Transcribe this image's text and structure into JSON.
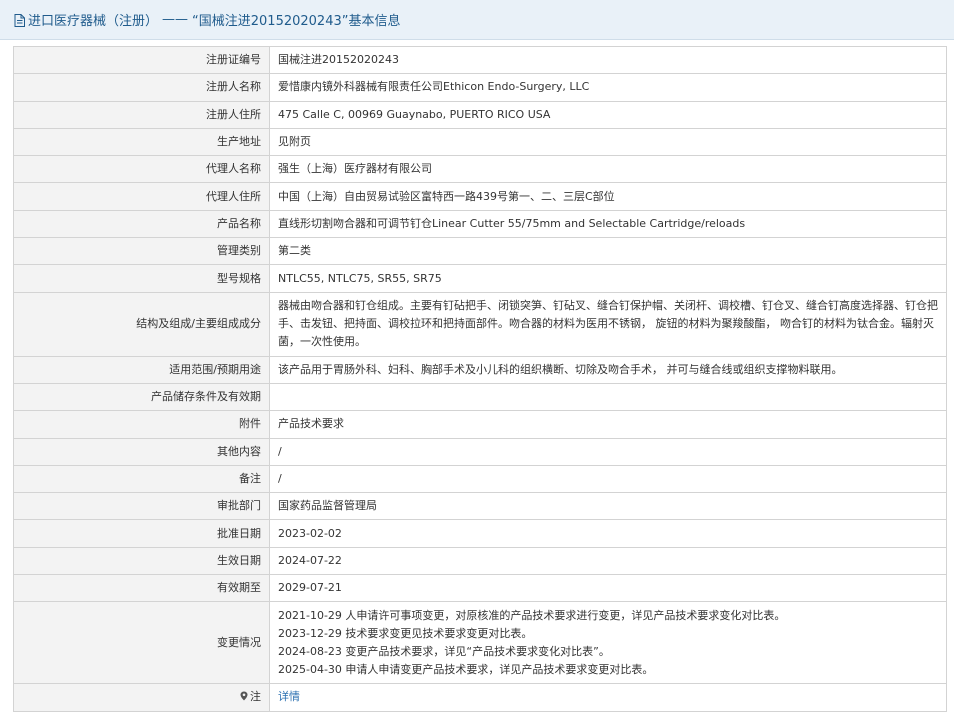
{
  "header": {
    "title_prefix": "进口医疗器械（注册）",
    "separator": "——",
    "title_main": "“国械注进20152020243”基本信息",
    "accent_color": "#1f5b8c",
    "icon": "document-icon"
  },
  "rows": [
    {
      "label": "注册证编号",
      "value": "国械注进20152020243"
    },
    {
      "label": "注册人名称",
      "value": "爱惜康内镜外科器械有限责任公司Ethicon Endo-Surgery, LLC"
    },
    {
      "label": "注册人住所",
      "value": "475 Calle C, 00969 Guaynabo, PUERTO RICO USA"
    },
    {
      "label": "生产地址",
      "value": "见附页"
    },
    {
      "label": "代理人名称",
      "value": "强生（上海）医疗器材有限公司"
    },
    {
      "label": "代理人住所",
      "value": "中国（上海）自由贸易试验区富特西一路439号第一、二、三层C部位"
    },
    {
      "label": "产品名称",
      "value": "直线形切割吻合器和可调节钉仓Linear Cutter 55/75mm and Selectable Cartridge/reloads"
    },
    {
      "label": "管理类别",
      "value": "第二类"
    },
    {
      "label": "型号规格",
      "value": "NTLC55, NTLC75, SR55, SR75"
    },
    {
      "label": "结构及组成/主要组成成分",
      "value": "器械由吻合器和钉仓组成。主要有钉砧把手、闭锁突笋、钉砧叉、缝合钉保护帽、关闭杆、调校槽、钉仓叉、缝合钉高度选择器、钉仓把手、击发钮、把持面、调校拉环和把持面部件。吻合器的材料为医用不锈钢， 旋钮的材料为聚羧酸酯， 吻合钉的材料为钛合金。辐射灭菌，一次性使用。"
    },
    {
      "label": "适用范围/预期用途",
      "value": "该产品用于胃肠外科、妇科、胸部手术及小儿科的组织横断、切除及吻合手术， 并可与缝合线或组织支撑物料联用。"
    },
    {
      "label": "产品储存条件及有效期",
      "value": ""
    },
    {
      "label": "附件",
      "value": "产品技术要求"
    },
    {
      "label": "其他内容",
      "value": "/"
    },
    {
      "label": "备注",
      "value": "/"
    },
    {
      "label": "审批部门",
      "value": "国家药品监督管理局"
    },
    {
      "label": "批准日期",
      "value": "2023-02-02"
    },
    {
      "label": "生效日期",
      "value": "2024-07-22"
    },
    {
      "label": "有效期至",
      "value": "2029-07-21"
    }
  ],
  "changes": {
    "label": "变更情况",
    "lines": [
      "2021-10-29 人申请许可事项变更，对原核准的产品技术要求进行变更，详见产品技术要求变化对比表。",
      "2023-12-29 技术要求变更见技术要求变更对比表。",
      "2024-08-23 变更产品技术要求，详见“产品技术要求变化对比表”。",
      "2025-04-30 申请人申请变更产品技术要求，详见产品技术要求变更对比表。"
    ]
  },
  "note": {
    "label": "注",
    "icon": "map-pin-icon",
    "link_text": "详情"
  }
}
